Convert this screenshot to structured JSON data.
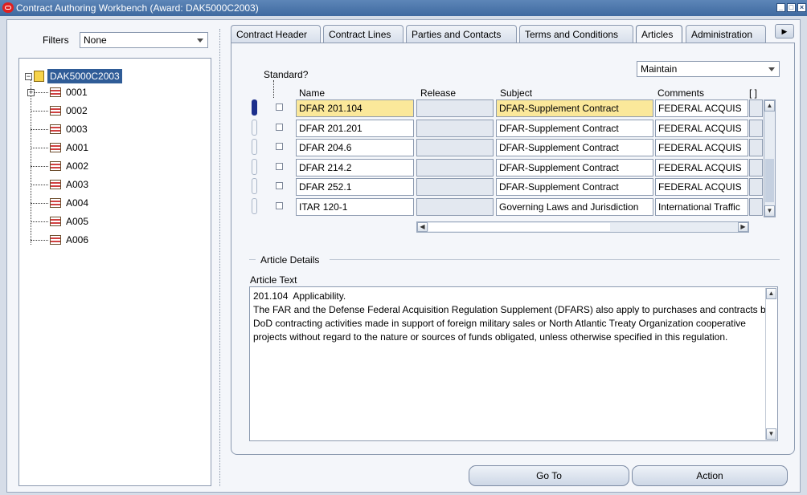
{
  "window": {
    "title": "Contract Authoring Workbench (Award: DAK5000C2003)"
  },
  "filters": {
    "label": "Filters",
    "value": "None"
  },
  "tree": {
    "root": "DAK5000C2003",
    "children": [
      "0001",
      "0002",
      "0003",
      "A001",
      "A002",
      "A003",
      "A004",
      "A005",
      "A006"
    ]
  },
  "tabs": [
    "Contract Header",
    "Contract Lines",
    "Parties and Contacts",
    "Terms and Conditions",
    "Articles",
    "Administration"
  ],
  "articles": {
    "standard_label": "Standard?",
    "mode_value": "Maintain",
    "columns": {
      "name": "Name",
      "release": "Release",
      "subject": "Subject",
      "comments": "Comments",
      "extra": "[ ]"
    },
    "rows": [
      {
        "name": "DFAR 201.104",
        "release": "",
        "subject": "DFAR-Supplement Contract",
        "comments": "FEDERAL ACQUIS"
      },
      {
        "name": "DFAR 201.201",
        "release": "",
        "subject": "DFAR-Supplement Contract",
        "comments": "FEDERAL ACQUIS"
      },
      {
        "name": "DFAR 204.6",
        "release": "",
        "subject": "DFAR-Supplement Contract",
        "comments": "FEDERAL ACQUIS"
      },
      {
        "name": "DFAR 214.2",
        "release": "",
        "subject": "DFAR-Supplement Contract",
        "comments": "FEDERAL ACQUIS"
      },
      {
        "name": "DFAR 252.1",
        "release": "",
        "subject": "DFAR-Supplement Contract",
        "comments": "FEDERAL ACQUIS"
      },
      {
        "name": "ITAR 120-1",
        "release": "",
        "subject": "Governing Laws and Jurisdiction",
        "comments": "International Traffic"
      }
    ]
  },
  "details": {
    "section_title": "Article Details",
    "text_label": "Article Text",
    "text": "201.104  Applicability.\nThe FAR and the Defense Federal Acquisition Regulation Supplement (DFARS) also apply to purchases and contracts by DoD contracting activities made in support of foreign military sales or North Atlantic Treaty Organization cooperative projects without regard to the nature or sources of funds obligated, unless otherwise specified in this regulation."
  },
  "buttons": {
    "goto": "Go To",
    "action": "Action"
  }
}
